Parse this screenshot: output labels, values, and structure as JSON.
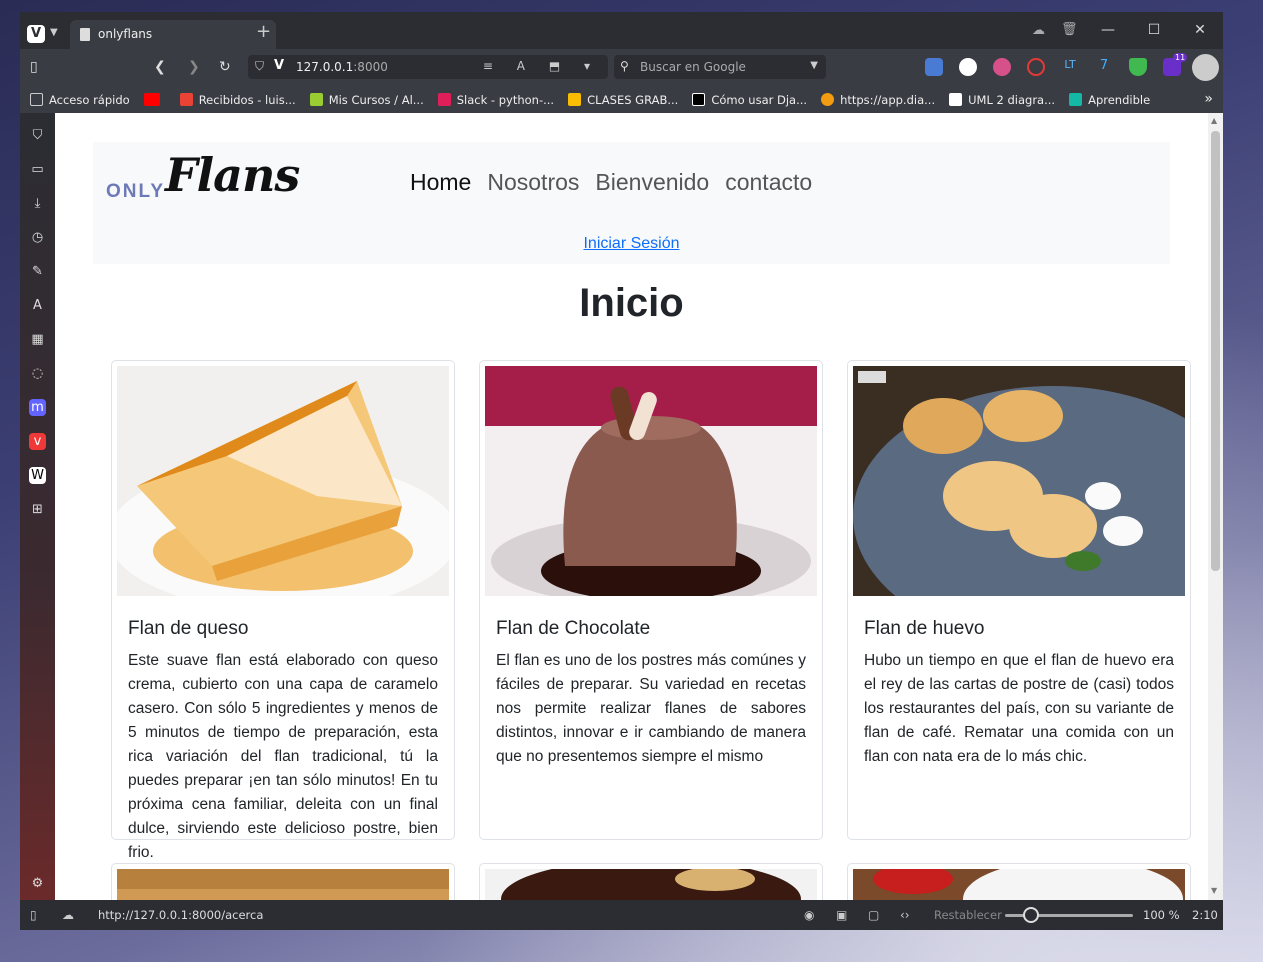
{
  "browser": {
    "tab_title": "onlyflans",
    "url_host": "127.0.0.1",
    "url_port": ":8000",
    "search_placeholder": "Buscar en Google",
    "status_url": "http://127.0.0.1:8000/acerca",
    "reset_label": "Restablecer",
    "zoom": "100 %",
    "time": "2:10",
    "extension_badge": "11"
  },
  "bookmarks": [
    {
      "label": "Acceso rápido",
      "color": "#cccccc"
    },
    {
      "label": "",
      "color": "#ff0000"
    },
    {
      "label": "Recibidos - luis...",
      "color": "#ea4335"
    },
    {
      "label": "Mis Cursos / Al...",
      "color": "#9acd32"
    },
    {
      "label": "Slack - python-...",
      "color": "#e01e5a"
    },
    {
      "label": "CLASES GRAB...",
      "color": "#fbbc04"
    },
    {
      "label": "Cómo usar Dja...",
      "color": "#000000"
    },
    {
      "label": "https://app.dia...",
      "color": "#f39c12"
    },
    {
      "label": "UML 2 diagra...",
      "color": "#ffffff"
    },
    {
      "label": "Aprendible",
      "color": "#14b8a6"
    }
  ],
  "site": {
    "brand_only": "ONLY",
    "brand_flans": "Flans",
    "nav": [
      "Home",
      "Nosotros",
      "Bienvenido",
      "contacto"
    ],
    "login": "Iniciar Sesión",
    "page_title": "Inicio"
  },
  "cards": [
    {
      "title": "Flan de queso",
      "text": "Este suave flan está elaborado con queso crema, cubierto con una capa de caramelo casero. Con sólo 5 ingredientes y menos de 5 minutos de tiempo de preparación, esta rica variación del flan tradicional, tú la puedes preparar ¡en tan sólo minutos! En tu próxima cena familiar, deleita con un final dulce, sirviendo este delicioso postre, bien frio."
    },
    {
      "title": "Flan de Chocolate",
      "text": "El flan es uno de los postres más comúnes y fáciles de preparar. Su variedad en recetas nos permite realizar flanes de sabores distintos, innovar e ir cambiando de manera que no presentemos siempre el mismo"
    },
    {
      "title": "Flan de huevo",
      "text": "Hubo un tiempo en que el flan de huevo era el rey de las cartas de postre de (casi) todos los restaurantes del país, con su variante de flan de café. Rematar una comida con un flan con nata era de lo más chic."
    }
  ],
  "colors": {
    "link": "#0d6efd",
    "brand_only": "#6c7ab8"
  }
}
